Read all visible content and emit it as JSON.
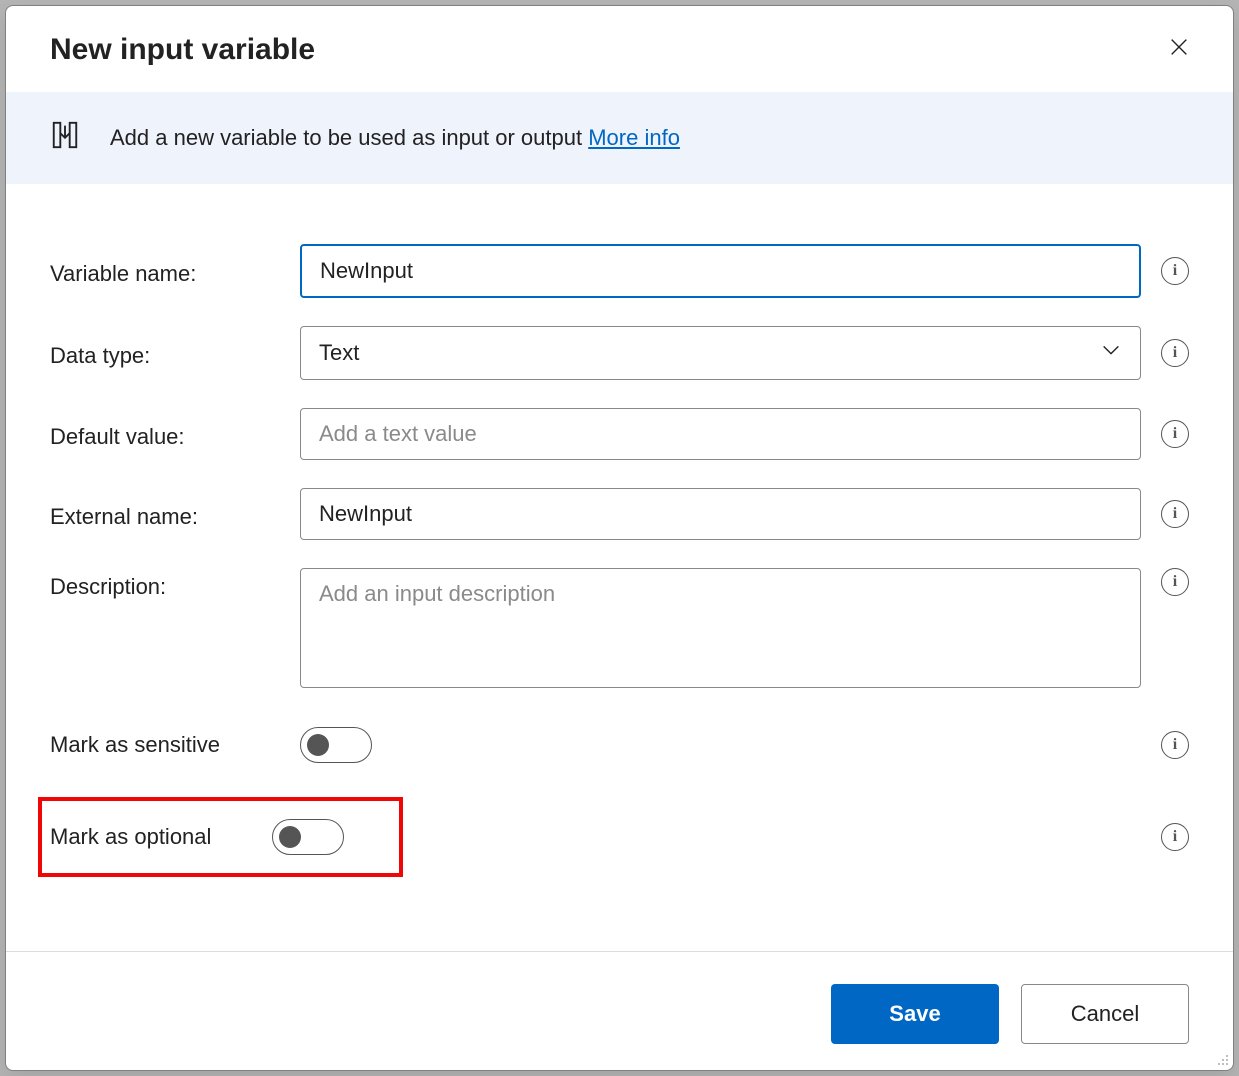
{
  "dialog": {
    "title": "New input variable"
  },
  "banner": {
    "text": "Add a new variable to be used as input or output ",
    "link": "More info"
  },
  "form": {
    "variable_name": {
      "label": "Variable name:",
      "value": "NewInput"
    },
    "data_type": {
      "label": "Data type:",
      "value": "Text"
    },
    "default_value": {
      "label": "Default value:",
      "placeholder": "Add a text value",
      "value": ""
    },
    "external_name": {
      "label": "External name:",
      "value": "NewInput"
    },
    "description": {
      "label": "Description:",
      "placeholder": "Add an input description",
      "value": ""
    },
    "mark_sensitive": {
      "label": "Mark as sensitive",
      "on": false
    },
    "mark_optional": {
      "label": "Mark as optional",
      "on": false
    }
  },
  "footer": {
    "save": "Save",
    "cancel": "Cancel"
  }
}
